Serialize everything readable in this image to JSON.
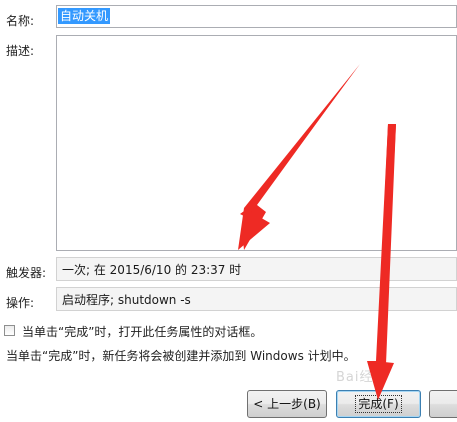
{
  "form": {
    "name_label": "名称:",
    "name_value": "自动关机",
    "description_label": "描述:",
    "description_value": "",
    "trigger_label": "触发器:",
    "trigger_value": "一次; 在 2015/6/10 的 23:37 时",
    "action_label": "操作:",
    "action_value": "启动程序; shutdown -s"
  },
  "options": {
    "open_properties_label": "当单击“完成”时，打开此任务属性的对话框。",
    "open_properties_checked": false,
    "info_text": "当单击“完成”时，新任务将会被创建并添加到 Windows 计划中。"
  },
  "buttons": {
    "back": "< 上一步(B)",
    "finish": "完成(F)"
  },
  "watermark": "Bai经验",
  "colors": {
    "arrow": "#ee2a24",
    "selection": "#3399ff"
  }
}
